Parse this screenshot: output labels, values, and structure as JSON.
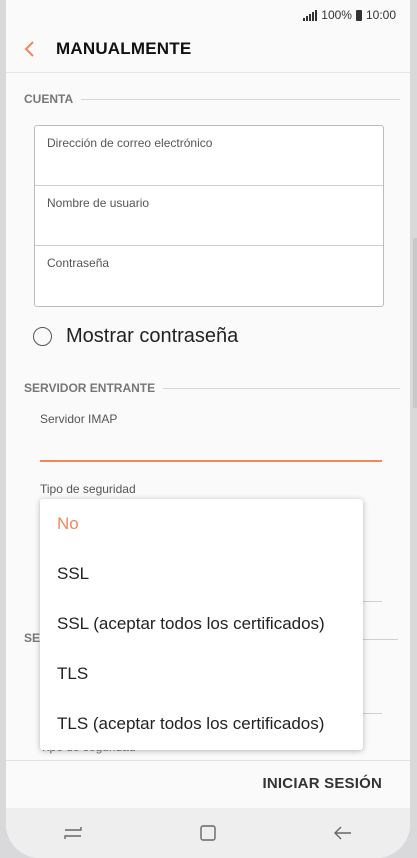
{
  "status_bar": {
    "battery": "100%",
    "time": "10:00"
  },
  "header": {
    "title": "MANUALMENTE",
    "back_icon": "chevron-left-icon"
  },
  "account_section": {
    "title": "CUENTA",
    "fields": [
      {
        "label": "Dirección de correo electrónico"
      },
      {
        "label": "Nombre de usuario"
      },
      {
        "label": "Contraseña"
      }
    ],
    "show_password_label": "Mostrar contraseña",
    "show_password_checked": false
  },
  "incoming_section": {
    "title": "SERVIDOR ENTRANTE",
    "imap_label": "Servidor IMAP",
    "security_label": "Tipo de seguridad"
  },
  "behind_dropdown": {
    "outgoing_section_fragment": "SE",
    "security_label_fragment": "Tipo de seguridad"
  },
  "security_dropdown": {
    "selected": "No",
    "options": [
      "No",
      "SSL",
      "SSL (aceptar todos los certificados)",
      "TLS",
      "TLS (aceptar todos los certificados)"
    ]
  },
  "footer": {
    "sign_in_label": "INICIAR SESIÓN"
  },
  "nav_bar": {
    "icons": [
      "recent-apps-icon",
      "home-icon",
      "back-arrow-icon"
    ]
  },
  "colors": {
    "accent": "#f0875d",
    "background": "#fafafa"
  }
}
